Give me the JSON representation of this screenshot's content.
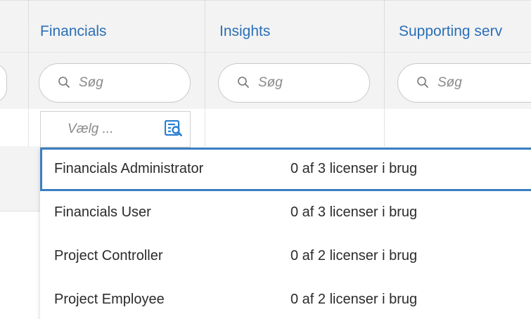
{
  "columns": [
    {
      "label": "Financials"
    },
    {
      "label": "Insights"
    },
    {
      "label": "Supporting serv"
    }
  ],
  "search": {
    "placeholder": "Søg"
  },
  "role_select": {
    "placeholder": "Vælg ..."
  },
  "colors": {
    "link_blue": "#2a6fb6",
    "highlight_border": "#3a7fc1",
    "header_bg": "#f3f3f3"
  },
  "dropdown": {
    "options": [
      {
        "name": "Financials Administrator",
        "licenses": "0 af 3 licenser i brug",
        "highlighted": true
      },
      {
        "name": "Financials User",
        "licenses": "0 af 3 licenser i brug",
        "highlighted": false
      },
      {
        "name": "Project Controller",
        "licenses": "0 af 2 licenser i brug",
        "highlighted": false
      },
      {
        "name": "Project Employee",
        "licenses": "0 af 2 licenser i brug",
        "highlighted": false
      }
    ]
  }
}
